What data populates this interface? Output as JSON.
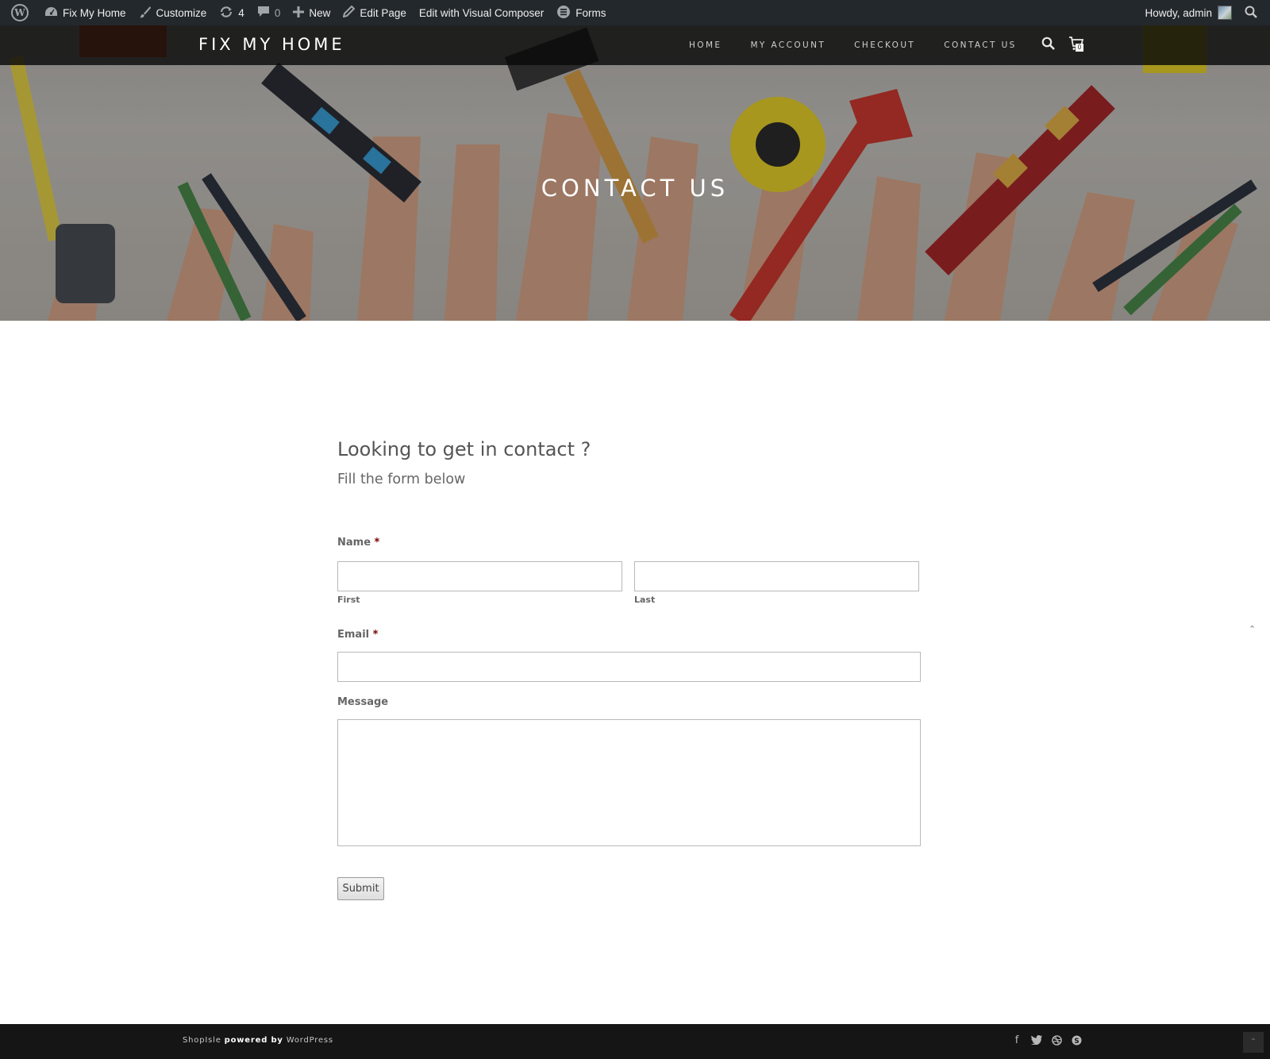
{
  "adminbar": {
    "site_name": "Fix My Home",
    "customize": "Customize",
    "updates_count": "4",
    "comments_count": "0",
    "new_label": "New",
    "edit_page": "Edit Page",
    "edit_visual": "Edit with Visual Composer",
    "forms": "Forms",
    "howdy": "Howdy, admin"
  },
  "site": {
    "brand": "FIX MY HOME",
    "menu": [
      "HOME",
      "MY ACCOUNT",
      "CHECKOUT",
      "CONTACT US"
    ],
    "cart_count": "0"
  },
  "hero": {
    "title": "CONTACT US"
  },
  "content": {
    "heading": "Looking to get in contact ?",
    "subheading": "Fill the form below"
  },
  "form": {
    "name_label": "Name",
    "required_mark": "*",
    "first_sublabel": "First",
    "last_sublabel": "Last",
    "email_label": "Email",
    "message_label": "Message",
    "submit_label": "Submit"
  },
  "footer": {
    "theme": "ShopIsle",
    "powered": "powered by",
    "platform": "WordPress",
    "social_icons": [
      "facebook-icon",
      "twitter-icon",
      "dribbble-icon",
      "skype-icon"
    ]
  },
  "icons": {
    "scroll_top": "scroll-top-icon"
  }
}
